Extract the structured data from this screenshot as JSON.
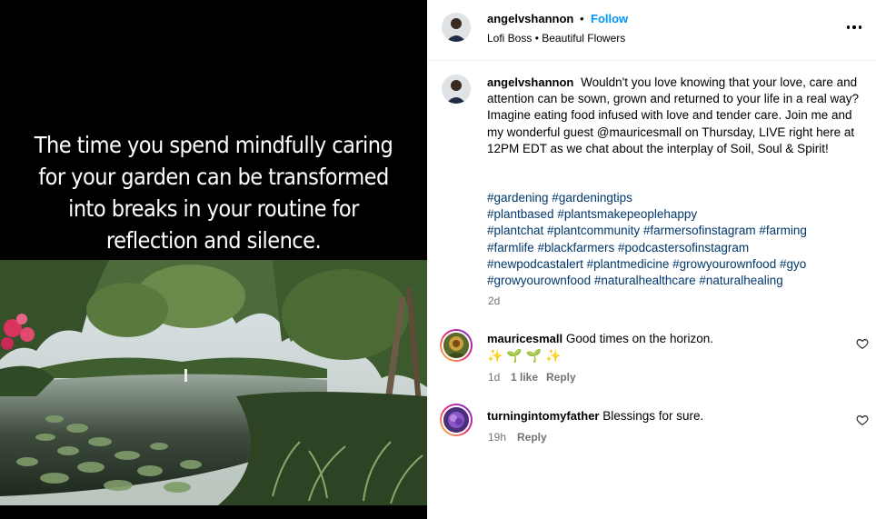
{
  "media": {
    "overlay_lines": [
      "The time you spend mindfully caring",
      "for your garden can be transformed",
      "into breaks in your routine for",
      "reflection and silence."
    ]
  },
  "post": {
    "author": "angelvshannon",
    "separator": "•",
    "follow_label": "Follow",
    "subtitle": "Lofi Boss • Beautiful Flowers",
    "caption_author": "angelvshannon",
    "caption_text": "Wouldn't you love knowing that your love, care and attention can be sown, grown and returned to your life in a real way? Imagine eating food infused with love and tender care. Join me and my wonderful guest @mauricesmall on Thursday, LIVE right here at 12PM EDT as we chat about the interplay of Soil, Soul & Spirit!",
    "hashtag_lines": [
      "#gardening #gardeningtips",
      "#plantbased #plantsmakepeoplehappy",
      "#plantchat #plantcommunity #farmersofinstagram #farming",
      "#farmlife #blackfarmers #podcastersofinstagram",
      "#newpodcastalert #plantmedicine #growyourownfood #gyo",
      "#growyourownfood #naturalhealthcare #naturalhealing"
    ],
    "timestamp": "2d"
  },
  "comments": [
    {
      "user": "mauricesmall",
      "text": "Good times on the horizon.",
      "emoji": "✨ 🌱 🌱 ✨",
      "time": "1d",
      "likes": "1 like",
      "reply": "Reply"
    },
    {
      "user": "turningintomyfather",
      "text": "Blessings for sure.",
      "time": "19h",
      "reply": "Reply"
    }
  ],
  "icons": {
    "more": "more-options-icon",
    "like": "heart-icon"
  },
  "colors": {
    "link_blue": "#0095f6",
    "hashtag_blue": "#00376b",
    "muted": "#737373"
  }
}
